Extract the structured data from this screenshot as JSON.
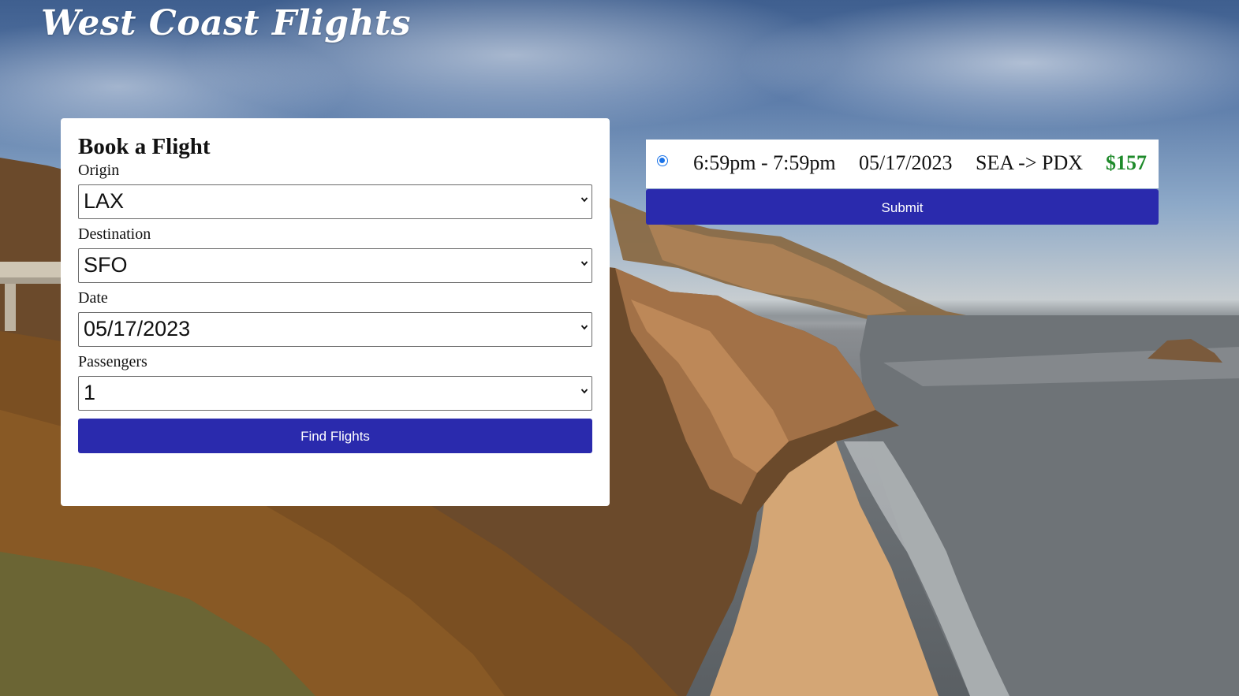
{
  "header": {
    "site_title": "West Coast Flights"
  },
  "booking_form": {
    "title": "Book a Flight",
    "origin_label": "Origin",
    "origin_value": "LAX",
    "destination_label": "Destination",
    "destination_value": "SFO",
    "date_label": "Date",
    "date_value": "05/17/2023",
    "passengers_label": "Passengers",
    "passengers_value": "1",
    "find_button_label": "Find Flights"
  },
  "results": {
    "flights": [
      {
        "selected": true,
        "time": "6:59pm - 7:59pm",
        "date": "05/17/2023",
        "route": "SEA -> PDX",
        "price": "$157"
      }
    ],
    "submit_label": "Submit"
  },
  "colors": {
    "button_bg": "#2a2aad",
    "price": "#1e8a2a",
    "radio_accent": "#1a73e8",
    "card_bg": "#ffffff"
  },
  "icons": {
    "dropdown": "chevron-down-icon",
    "selection": "radio-icon"
  }
}
